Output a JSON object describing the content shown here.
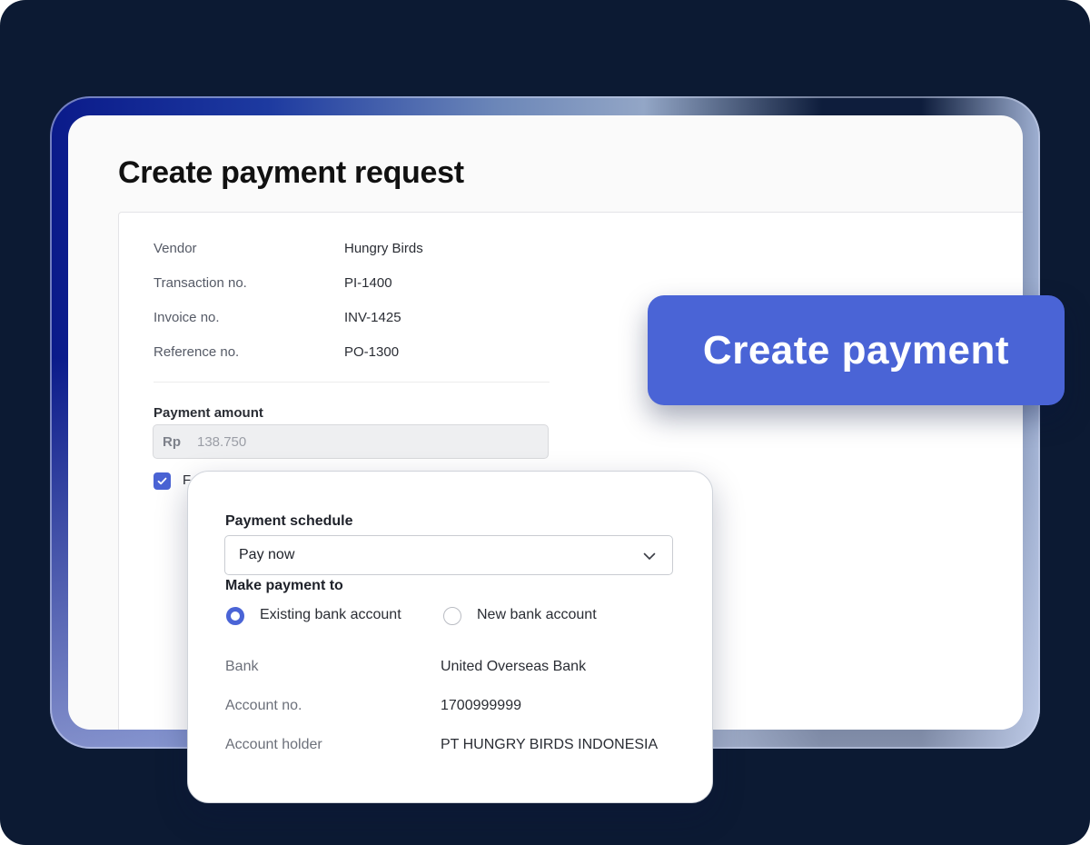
{
  "page": {
    "title": "Create payment request"
  },
  "details": [
    {
      "label": "Vendor",
      "value": "Hungry Birds"
    },
    {
      "label": "Transaction no.",
      "value": "PI-1400"
    },
    {
      "label": "Invoice no.",
      "value": "INV-1425"
    },
    {
      "label": "Reference no.",
      "value": "PO-1300"
    }
  ],
  "payment_amount": {
    "label": "Payment amount",
    "currency_prefix": "Rp",
    "value": "138.750"
  },
  "checkbox": {
    "label": "F",
    "checked": true
  },
  "create_button": {
    "label": "Create payment"
  },
  "schedule_card": {
    "schedule_label": "Payment schedule",
    "schedule_value": "Pay now",
    "make_payment_label": "Make payment to",
    "options": [
      {
        "label": "Existing bank account",
        "selected": true
      },
      {
        "label": "New bank account",
        "selected": false
      }
    ],
    "account": [
      {
        "label": "Bank",
        "value": "United Overseas Bank"
      },
      {
        "label": "Account no.",
        "value": "1700999999"
      },
      {
        "label": "Account holder",
        "value": "PT HUNGRY BIRDS INDONESIA"
      }
    ]
  },
  "colors": {
    "background": "#0c1a33",
    "accent": "#4a64d6"
  },
  "icons": {
    "checkbox": "check-icon",
    "select": "chevron-down-icon"
  }
}
